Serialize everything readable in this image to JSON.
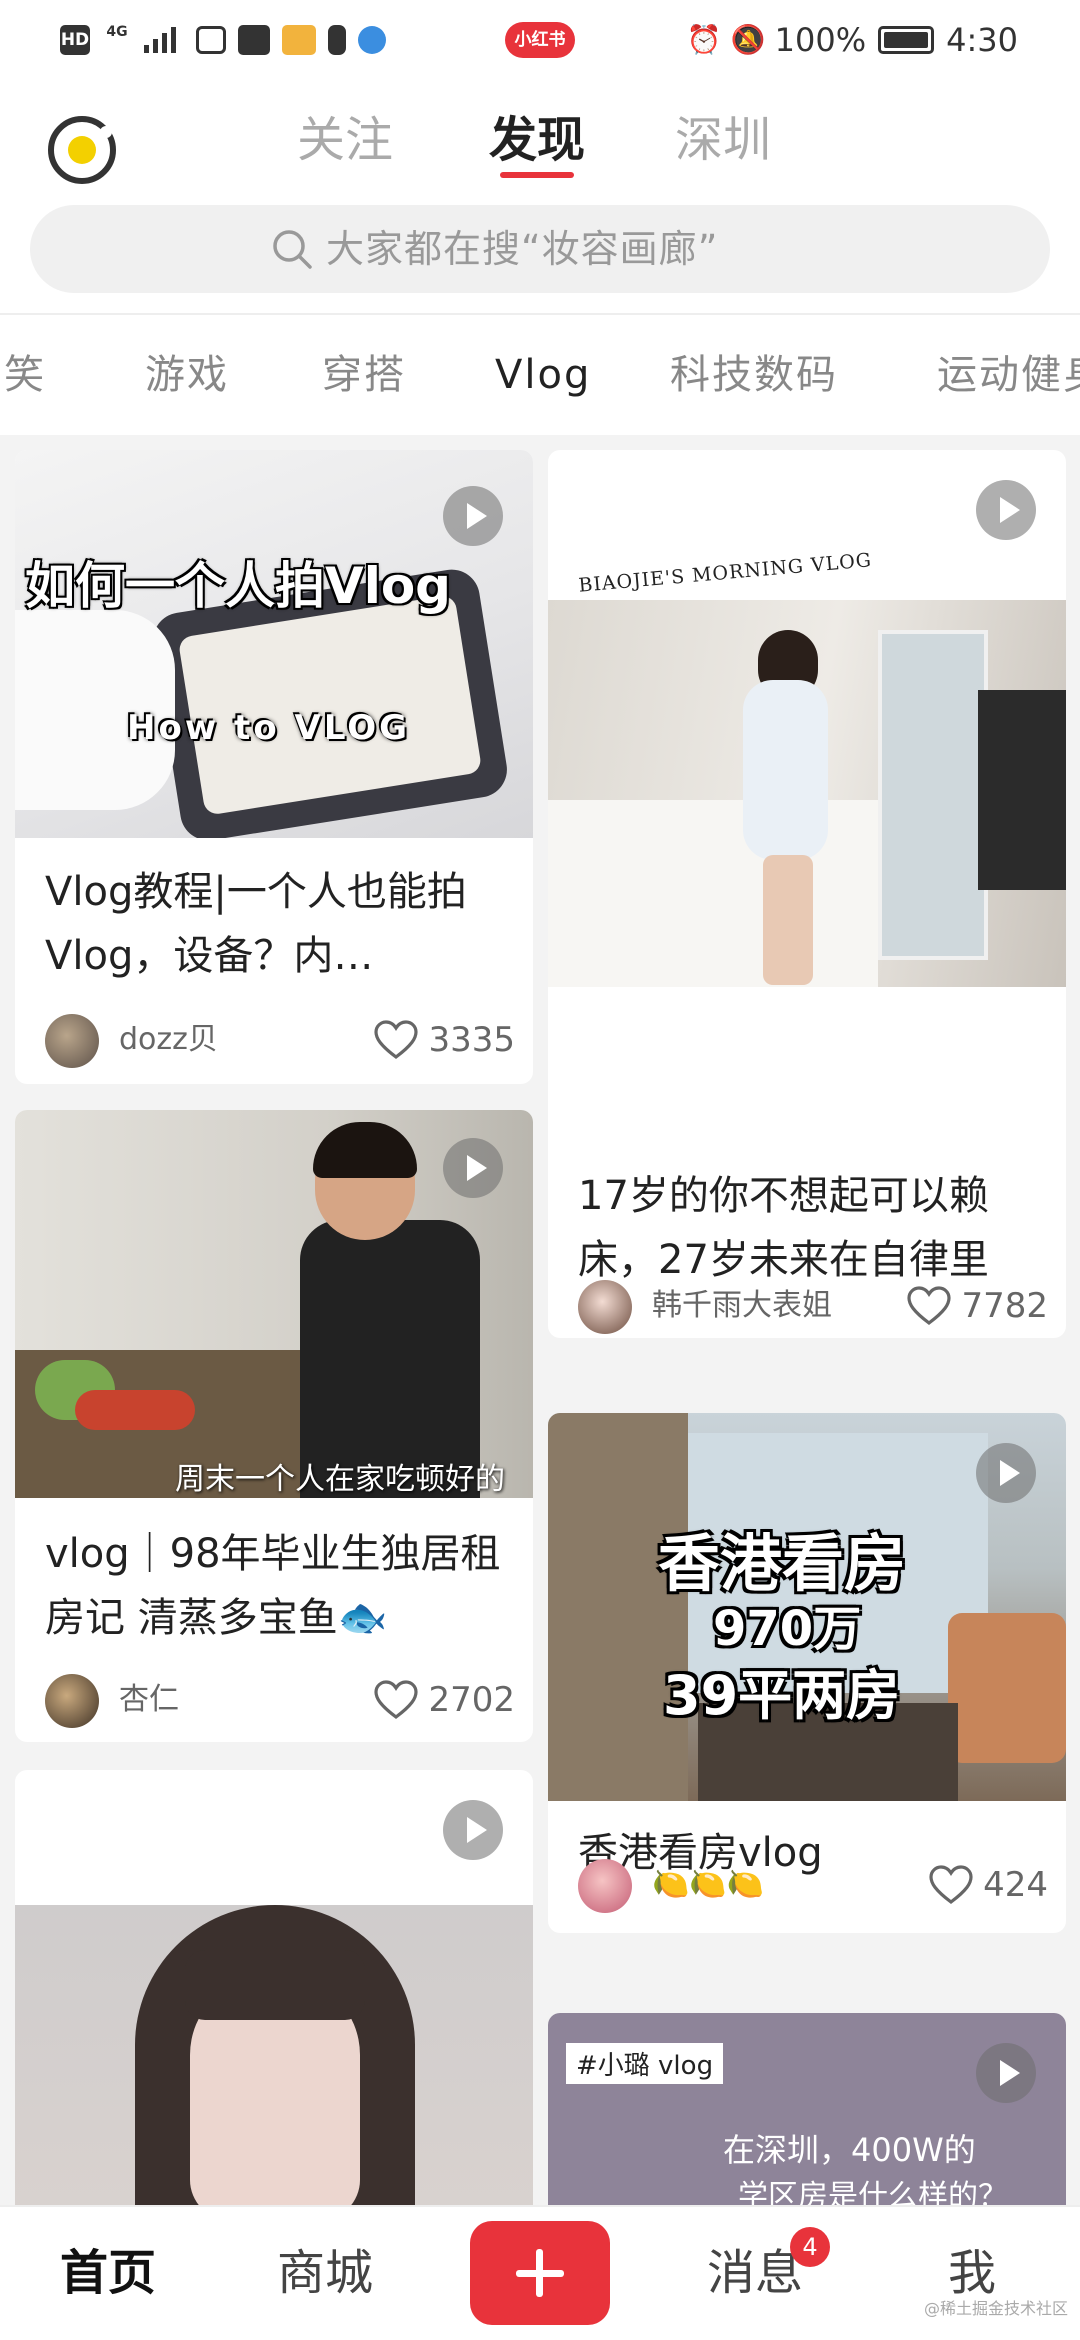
{
  "status_bar": {
    "hd": "HD",
    "network": "4G",
    "brand": "小红书",
    "battery": "100%",
    "time": "4:30"
  },
  "header": {
    "tabs": [
      "关注",
      "发现",
      "深圳"
    ],
    "active_tab": 1,
    "search_placeholder": "大家都在搜“妆容画廊”"
  },
  "categories": [
    "搞笑",
    "游戏",
    "穿搭",
    "Vlog",
    "科技数码",
    "运动健身"
  ],
  "active_category": 3,
  "feed": [
    {
      "title": "Vlog教程|一个人也能拍Vlog，设备？内…",
      "author": "dozz贝",
      "likes": "3335",
      "overlay_lines": [
        "如何一个人拍Vlog",
        "How to VLOG"
      ]
    },
    {
      "title": "17岁的你不想起可以赖床，27岁未来在自律里",
      "author": "韩千雨大表姐",
      "likes": "7782",
      "overlay_lines": [
        "BIAOJIE'S MORNING VLOG"
      ]
    },
    {
      "title": "vlog｜98年毕业生独居租房记 清蒸多宝鱼🐟",
      "author": "杏仁",
      "likes": "2702",
      "overlay_lines": [
        "周末一个人在家吃顿好的"
      ]
    },
    {
      "title": "香港看房vlog",
      "author": "🍋🍋🍋",
      "likes": "424",
      "overlay_lines": [
        "香港看房",
        "970万",
        "39平两房"
      ]
    },
    {
      "title": "",
      "author": "",
      "likes": "",
      "overlay_lines": []
    },
    {
      "title": "",
      "author": "",
      "likes": "",
      "overlay_lines": [
        "#小璐 vlog",
        "在深圳，400W的",
        "学区房是什么样的？"
      ]
    }
  ],
  "bottom_nav": {
    "items": [
      "首页",
      "商城",
      "消息",
      "我"
    ],
    "active": 0,
    "message_badge": "4"
  },
  "watermark": "@稀土掘金技术社区",
  "colors": {
    "accent": "#e8333b",
    "text_primary": "#222222",
    "text_secondary": "#888888",
    "background": "#f3f3f3"
  }
}
